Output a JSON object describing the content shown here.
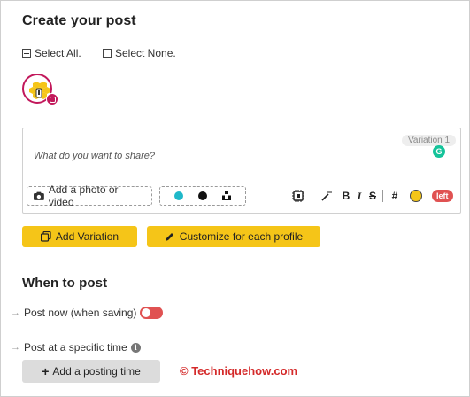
{
  "create": {
    "title": "Create your post",
    "select_all": "Select All.",
    "select_none": "Select None."
  },
  "composer": {
    "variation_label": "Variation 1",
    "grammarly_letter": "G",
    "placeholder": "What do you want to share?",
    "add_media_label": "Add a photo or video",
    "counter_label": "left",
    "toolbar": [
      "bold-icon",
      "italic-icon",
      "strikethrough-icon",
      "hashtag-icon",
      "emoji-icon"
    ]
  },
  "actions": {
    "add_variation": "Add Variation",
    "customize": "Customize for each profile"
  },
  "when": {
    "title": "When to post",
    "post_now": "Post now (when saving)",
    "post_at_time": "Post at a specific time",
    "add_time": "Add a posting time"
  },
  "watermark": "© Techniquehow.com",
  "colors": {
    "accent_yellow": "#f5c518",
    "toggle_red": "#e05252",
    "profile_ring": "#c2185b"
  }
}
